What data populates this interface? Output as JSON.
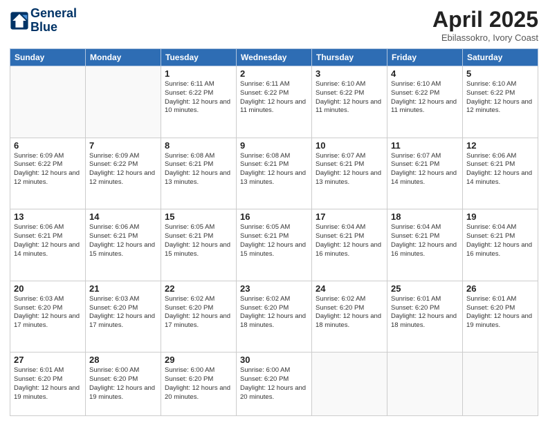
{
  "header": {
    "logo_line1": "General",
    "logo_line2": "Blue",
    "title": "April 2025",
    "subtitle": "Ebilassokro, Ivory Coast"
  },
  "weekdays": [
    "Sunday",
    "Monday",
    "Tuesday",
    "Wednesday",
    "Thursday",
    "Friday",
    "Saturday"
  ],
  "weeks": [
    [
      {
        "day": "",
        "info": ""
      },
      {
        "day": "",
        "info": ""
      },
      {
        "day": "1",
        "info": "Sunrise: 6:11 AM\nSunset: 6:22 PM\nDaylight: 12 hours and 10 minutes."
      },
      {
        "day": "2",
        "info": "Sunrise: 6:11 AM\nSunset: 6:22 PM\nDaylight: 12 hours and 11 minutes."
      },
      {
        "day": "3",
        "info": "Sunrise: 6:10 AM\nSunset: 6:22 PM\nDaylight: 12 hours and 11 minutes."
      },
      {
        "day": "4",
        "info": "Sunrise: 6:10 AM\nSunset: 6:22 PM\nDaylight: 12 hours and 11 minutes."
      },
      {
        "day": "5",
        "info": "Sunrise: 6:10 AM\nSunset: 6:22 PM\nDaylight: 12 hours and 12 minutes."
      }
    ],
    [
      {
        "day": "6",
        "info": "Sunrise: 6:09 AM\nSunset: 6:22 PM\nDaylight: 12 hours and 12 minutes."
      },
      {
        "day": "7",
        "info": "Sunrise: 6:09 AM\nSunset: 6:22 PM\nDaylight: 12 hours and 12 minutes."
      },
      {
        "day": "8",
        "info": "Sunrise: 6:08 AM\nSunset: 6:21 PM\nDaylight: 12 hours and 13 minutes."
      },
      {
        "day": "9",
        "info": "Sunrise: 6:08 AM\nSunset: 6:21 PM\nDaylight: 12 hours and 13 minutes."
      },
      {
        "day": "10",
        "info": "Sunrise: 6:07 AM\nSunset: 6:21 PM\nDaylight: 12 hours and 13 minutes."
      },
      {
        "day": "11",
        "info": "Sunrise: 6:07 AM\nSunset: 6:21 PM\nDaylight: 12 hours and 14 minutes."
      },
      {
        "day": "12",
        "info": "Sunrise: 6:06 AM\nSunset: 6:21 PM\nDaylight: 12 hours and 14 minutes."
      }
    ],
    [
      {
        "day": "13",
        "info": "Sunrise: 6:06 AM\nSunset: 6:21 PM\nDaylight: 12 hours and 14 minutes."
      },
      {
        "day": "14",
        "info": "Sunrise: 6:06 AM\nSunset: 6:21 PM\nDaylight: 12 hours and 15 minutes."
      },
      {
        "day": "15",
        "info": "Sunrise: 6:05 AM\nSunset: 6:21 PM\nDaylight: 12 hours and 15 minutes."
      },
      {
        "day": "16",
        "info": "Sunrise: 6:05 AM\nSunset: 6:21 PM\nDaylight: 12 hours and 15 minutes."
      },
      {
        "day": "17",
        "info": "Sunrise: 6:04 AM\nSunset: 6:21 PM\nDaylight: 12 hours and 16 minutes."
      },
      {
        "day": "18",
        "info": "Sunrise: 6:04 AM\nSunset: 6:21 PM\nDaylight: 12 hours and 16 minutes."
      },
      {
        "day": "19",
        "info": "Sunrise: 6:04 AM\nSunset: 6:21 PM\nDaylight: 12 hours and 16 minutes."
      }
    ],
    [
      {
        "day": "20",
        "info": "Sunrise: 6:03 AM\nSunset: 6:20 PM\nDaylight: 12 hours and 17 minutes."
      },
      {
        "day": "21",
        "info": "Sunrise: 6:03 AM\nSunset: 6:20 PM\nDaylight: 12 hours and 17 minutes."
      },
      {
        "day": "22",
        "info": "Sunrise: 6:02 AM\nSunset: 6:20 PM\nDaylight: 12 hours and 17 minutes."
      },
      {
        "day": "23",
        "info": "Sunrise: 6:02 AM\nSunset: 6:20 PM\nDaylight: 12 hours and 18 minutes."
      },
      {
        "day": "24",
        "info": "Sunrise: 6:02 AM\nSunset: 6:20 PM\nDaylight: 12 hours and 18 minutes."
      },
      {
        "day": "25",
        "info": "Sunrise: 6:01 AM\nSunset: 6:20 PM\nDaylight: 12 hours and 18 minutes."
      },
      {
        "day": "26",
        "info": "Sunrise: 6:01 AM\nSunset: 6:20 PM\nDaylight: 12 hours and 19 minutes."
      }
    ],
    [
      {
        "day": "27",
        "info": "Sunrise: 6:01 AM\nSunset: 6:20 PM\nDaylight: 12 hours and 19 minutes."
      },
      {
        "day": "28",
        "info": "Sunrise: 6:00 AM\nSunset: 6:20 PM\nDaylight: 12 hours and 19 minutes."
      },
      {
        "day": "29",
        "info": "Sunrise: 6:00 AM\nSunset: 6:20 PM\nDaylight: 12 hours and 20 minutes."
      },
      {
        "day": "30",
        "info": "Sunrise: 6:00 AM\nSunset: 6:20 PM\nDaylight: 12 hours and 20 minutes."
      },
      {
        "day": "",
        "info": ""
      },
      {
        "day": "",
        "info": ""
      },
      {
        "day": "",
        "info": ""
      }
    ]
  ]
}
